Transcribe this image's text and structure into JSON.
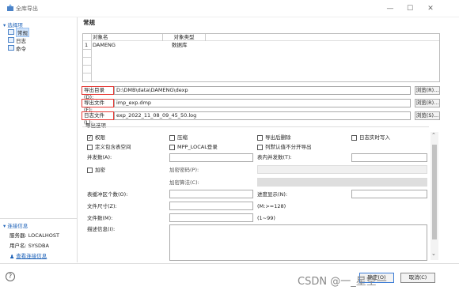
{
  "window": {
    "title": "全库导出",
    "minimize": "—",
    "maximize": "☐",
    "close": "✕"
  },
  "sidebar": {
    "options_header": "▾ 选择项",
    "items": [
      {
        "label": "常规"
      },
      {
        "label": "日志"
      },
      {
        "label": "命令"
      }
    ],
    "conn_header": "▾ 连接信息",
    "server": "服务器: LOCALHOST",
    "user": "用户名: SYSDBA",
    "view_conn": "查看连接信息"
  },
  "main": {
    "heading": "常规",
    "table": {
      "columns": [
        "对象名",
        "对象类型"
      ],
      "rows": [
        {
          "num": "1",
          "name": "DAMENG",
          "type": "数据库"
        }
      ]
    },
    "export_dir": {
      "label": "导出目录(D):",
      "value": "D:\\DMB\\data\\DAMENG\\dexp",
      "browse": "浏览(R)..."
    },
    "export_file": {
      "label": "导出文件(F):",
      "value": "imp_exp.dmp",
      "browse": "浏览(R)..."
    },
    "log_file": {
      "label": "日志文件(L):",
      "value": "exp_2022_11_08_09_45_50.log",
      "browse": "浏览(S)..."
    },
    "options_title": "导出选项",
    "checkboxes": [
      {
        "label": "权限",
        "checked": true
      },
      {
        "label": "压缩",
        "checked": false
      },
      {
        "label": "导出后删除",
        "checked": false
      },
      {
        "label": "日志实时写入",
        "checked": false
      },
      {
        "label": "定义包含表空间",
        "checked": false
      },
      {
        "label": "MPP_LOCAL登录",
        "checked": false
      },
      {
        "label": "列默认值不分开导出",
        "checked": false
      },
      {
        "label": "加密",
        "checked": false
      }
    ],
    "parallel_label": "并发数(A):",
    "table_parallel_label": "表内并发数(T):",
    "encrypt_pwd_label": "加密密码(P):",
    "encrypt_algo_label": "加密算法(C):",
    "tablebuf_label": "表缓冲区个数(O):",
    "progress_label": "进度显示(N):",
    "filesize_label": "文件尺寸(Z):",
    "filesize_hint": "(M:>=128)",
    "filenum_label": "文件数(M):",
    "filenum_hint": "(1~99)",
    "desc_label": "描述信息(I):"
  },
  "footer": {
    "help": "?",
    "ok": "确定(O)",
    "cancel": "取消(C)"
  },
  "watermark": "CSDN @一_星空一"
}
